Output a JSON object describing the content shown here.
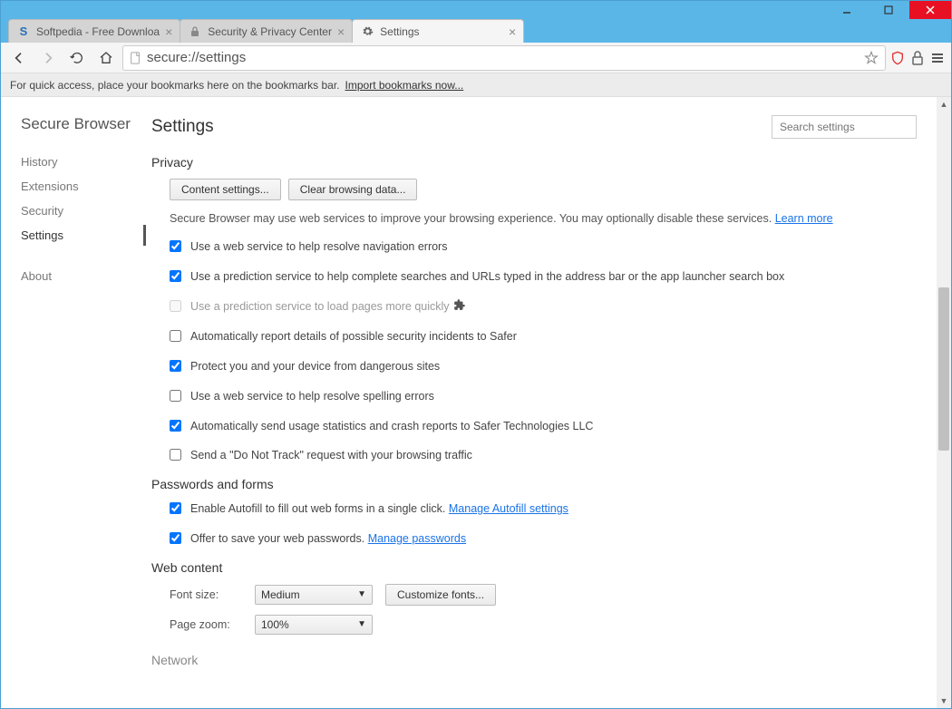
{
  "window": {
    "tabs": [
      {
        "title": "Softpedia - Free Downloa",
        "favicon": "S"
      },
      {
        "title": "Security & Privacy Center",
        "favicon": "lock"
      },
      {
        "title": "Settings",
        "favicon": "gear"
      }
    ],
    "active_tab": 2
  },
  "toolbar": {
    "url": "secure://settings"
  },
  "bookmarks_bar": {
    "text": "For quick access, place your bookmarks here on the bookmarks bar.",
    "link": "Import bookmarks now..."
  },
  "sidebar": {
    "brand": "Secure Browser",
    "items": [
      "History",
      "Extensions",
      "Security",
      "Settings"
    ],
    "footer": "About",
    "active": "Settings"
  },
  "main": {
    "title": "Settings",
    "search_placeholder": "Search settings",
    "privacy": {
      "title": "Privacy",
      "content_settings": "Content settings...",
      "clear_data": "Clear browsing data...",
      "explain_prefix": "Secure Browser may use web services to improve your browsing experience. You may optionally disable these services. ",
      "learn_more": "Learn more",
      "checks": [
        {
          "label": "Use a web service to help resolve navigation errors",
          "checked": true,
          "disabled": false
        },
        {
          "label": "Use a prediction service to help complete searches and URLs typed in the address bar or the app launcher search box",
          "checked": true,
          "disabled": false
        },
        {
          "label": "Use a prediction service to load pages more quickly",
          "checked": false,
          "disabled": true,
          "puzzle": true
        },
        {
          "label": "Automatically report details of possible security incidents to Safer",
          "checked": false,
          "disabled": false
        },
        {
          "label": "Protect you and your device from dangerous sites",
          "checked": true,
          "disabled": false
        },
        {
          "label": "Use a web service to help resolve spelling errors",
          "checked": false,
          "disabled": false
        },
        {
          "label": "Automatically send usage statistics and crash reports to Safer Technologies LLC",
          "checked": true,
          "disabled": false
        },
        {
          "label": "Send a \"Do Not Track\" request with your browsing traffic",
          "checked": false,
          "disabled": false
        }
      ]
    },
    "passwords": {
      "title": "Passwords and forms",
      "autofill_label": "Enable Autofill to fill out web forms in a single click.",
      "autofill_link": "Manage Autofill settings",
      "autofill_checked": true,
      "savepw_label": "Offer to save your web passwords.",
      "savepw_link": "Manage passwords",
      "savepw_checked": true
    },
    "web_content": {
      "title": "Web content",
      "font_size_label": "Font size:",
      "font_size_value": "Medium",
      "customize_fonts": "Customize fonts...",
      "page_zoom_label": "Page zoom:",
      "page_zoom_value": "100%"
    },
    "network": {
      "title": "Network"
    }
  }
}
